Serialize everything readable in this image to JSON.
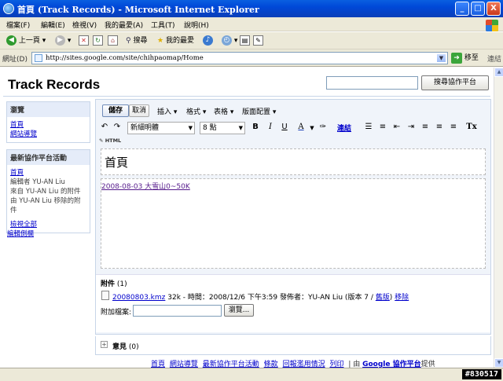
{
  "window": {
    "title": "首頁 (Track Records) - Microsoft Internet Explorer",
    "controls": [
      "_",
      "□",
      "X"
    ]
  },
  "menubar": [
    "檔案(F)",
    "編輯(E)",
    "檢視(V)",
    "我的最愛(A)",
    "工具(T)",
    "說明(H)"
  ],
  "toolbar": {
    "back": "上一頁",
    "search": "搜尋",
    "favorites": "我的最愛"
  },
  "address": {
    "label": "網址(D)",
    "url": "http://sites.google.com/site/chihpaomap/Home",
    "go": "移至",
    "links": "連結"
  },
  "site": {
    "title": "Track Records",
    "search_button": "搜尋協作平台"
  },
  "sidebar": {
    "nav_title": "瀏覽",
    "nav_items": [
      "首頁",
      "網站導覽"
    ],
    "activity_title": "最新協作平台活動",
    "activity_link": "首頁",
    "activity_lines": [
      "編輯者 YU-AN Liu",
      "來自 YU-AN Liu 的附件",
      "由 YU-AN Liu 移除的附件"
    ],
    "view_all": "檢視全部",
    "edit_sidebar": "編輯側欄"
  },
  "editor": {
    "save": "儲存",
    "cancel": "取消",
    "menus": [
      "插入 ▾",
      "格式 ▾",
      "表格 ▾",
      "版面配置 ▾"
    ],
    "font": "新細明體",
    "size": "8 點",
    "buttons": {
      "bold": "B",
      "italic": "I",
      "underline": "U",
      "text_color": "A",
      "link": "連結",
      "clear": "Tx"
    },
    "html": "HTML",
    "page_title": "首頁",
    "body_link": "2008-08-03 大雪山0~50K"
  },
  "attachments": {
    "label": "附件",
    "count": "(1)",
    "file_name": "20080803.kmz",
    "file_info": "32k - 時間：2008/12/6 下午3:59 發佈者：YU-AN Liu (版本 7 / ",
    "older": "舊版",
    "close_paren": ") ",
    "remove": "移除",
    "add_label": "附加檔案:",
    "browse": "瀏覽..."
  },
  "comments": {
    "label": "意見",
    "count": "(0)"
  },
  "footer": {
    "links": [
      "首頁",
      "網站導覽",
      "最新協作平台活動",
      "條款",
      "回報濫用情況",
      "列印"
    ],
    "powered_prefix": "| 由 ",
    "brand": "Google 協作平台",
    "powered_suffix": "提供"
  },
  "watermark": "#830517"
}
